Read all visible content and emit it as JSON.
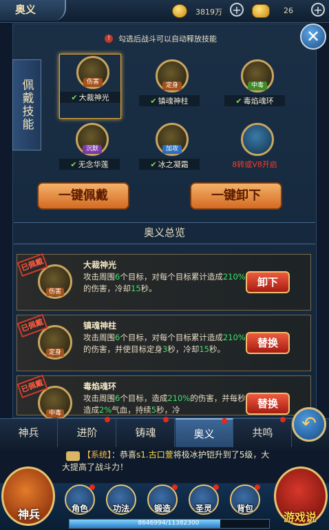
{
  "header": {
    "title": "奥义",
    "gold": "3819万",
    "ingots": "26"
  },
  "hint": "勾选后战斗可以自动释放技能",
  "equip_label": "佩戴技能",
  "skills": [
    {
      "name": "大裁神光",
      "tag": "伤害",
      "checked": true,
      "selected": true,
      "tag_color": "#a4521c"
    },
    {
      "name": "镇魂神柱",
      "tag": "定身",
      "checked": true,
      "selected": false,
      "tag_color": "#a4521c"
    },
    {
      "name": "毒焰魂环",
      "tag": "中毒",
      "checked": true,
      "selected": false,
      "tag_color": "#3f8a2a"
    },
    {
      "name": "无念华莲",
      "tag": "沉默",
      "checked": true,
      "selected": false,
      "tag_color": "#7a3aa8"
    },
    {
      "name": "冰之凝霜",
      "tag": "加攻",
      "checked": true,
      "selected": false,
      "tag_color": "#2b6fc0"
    },
    {
      "name": "8转或V8开启",
      "tag": "",
      "checked": false,
      "selected": false,
      "locked": true
    }
  ],
  "buttons": {
    "equip_all": "一键佩戴",
    "unequip_all": "一键卸下"
  },
  "overview": {
    "title": "奥义总览",
    "stamp": "已佩戴",
    "entries": [
      {
        "name": "大裁神光",
        "tag": "伤害",
        "btn": "卸下",
        "desc": [
          [
            "攻击周围",
            ""
          ],
          [
            "6",
            "hl"
          ],
          [
            "个目标，对每个目标累计造成",
            ""
          ],
          [
            "210%",
            "hl"
          ],
          [
            "的伤害，冷却",
            ""
          ],
          [
            "15",
            "hl"
          ],
          [
            "秒。",
            ""
          ]
        ]
      },
      {
        "name": "镇魂神柱",
        "tag": "定身",
        "btn": "替换",
        "desc": [
          [
            "攻击周围",
            ""
          ],
          [
            "6",
            "hl"
          ],
          [
            "个目标，对每个目标累计造成",
            ""
          ],
          [
            "210%",
            "hl"
          ],
          [
            "的伤害，并使目标定身",
            ""
          ],
          [
            "3",
            "hl"
          ],
          [
            "秒，冷却",
            ""
          ],
          [
            "15",
            "hl"
          ],
          [
            "秒。",
            ""
          ]
        ]
      },
      {
        "name": "毒焰魂环",
        "tag": "中毒",
        "btn": "替换",
        "desc": [
          [
            "攻击周围",
            ""
          ],
          [
            "6",
            "hl"
          ],
          [
            "个目标，造成",
            ""
          ],
          [
            "210%",
            "hl"
          ],
          [
            "的伤害，并每秒造成",
            ""
          ],
          [
            "2%",
            "hl"
          ],
          [
            "气血，持续",
            ""
          ],
          [
            "5",
            "hl"
          ],
          [
            "秒，冷",
            ""
          ]
        ]
      }
    ]
  },
  "tabs": [
    {
      "label": "神兵",
      "dot": false,
      "active": false
    },
    {
      "label": "进阶",
      "dot": true,
      "active": false
    },
    {
      "label": "铸魂",
      "dot": true,
      "active": false
    },
    {
      "label": "奥义",
      "dot": true,
      "active": true
    },
    {
      "label": "共鸣",
      "dot": true,
      "active": false
    }
  ],
  "chat": {
    "system_tag": "【系统】",
    "parts": [
      [
        "：恭喜",
        ""
      ],
      [
        "s1.古口萱",
        "hl"
      ],
      [
        "将极冰护铠升到了5级，大大提高了战斗力！",
        ""
      ]
    ]
  },
  "bottom_nav": {
    "big_left": "神兵",
    "items": [
      {
        "label": "角色",
        "dot": true
      },
      {
        "label": "功法",
        "dot": false
      },
      {
        "label": "锻造",
        "dot": true
      },
      {
        "label": "圣灵",
        "dot": true
      },
      {
        "label": "背包",
        "dot": true
      }
    ],
    "exp_text": "8646994/11382300",
    "exp_fraction": 0.76
  },
  "watermark": "游戏说"
}
